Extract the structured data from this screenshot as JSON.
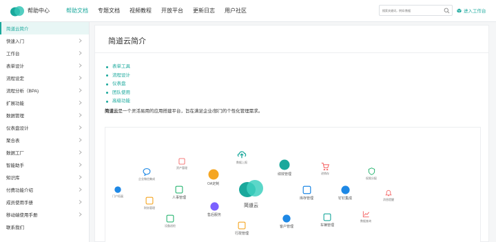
{
  "header": {
    "brand": "帮助中心",
    "nav": [
      "帮助文档",
      "专题文档",
      "视频教程",
      "开放平台",
      "更新日志",
      "用户社区"
    ],
    "active_nav": 0,
    "search_placeholder": "搜索关键词，例如:数据",
    "enter_workspace": "进入工作台",
    "accent_color": "#1aa89c",
    "icons": {
      "search": "search-icon",
      "workspace": "cube-icon",
      "logo": "cloud-logo"
    }
  },
  "sidebar": {
    "items": [
      {
        "label": "简道云简介",
        "active": true,
        "has_chevron": false
      },
      {
        "label": "快速入门",
        "has_chevron": true
      },
      {
        "label": "工作台",
        "has_chevron": true
      },
      {
        "label": "表单设计",
        "has_chevron": true
      },
      {
        "label": "流程设定",
        "has_chevron": true
      },
      {
        "label": "流程分析（BPA)",
        "has_chevron": true
      },
      {
        "label": "扩展功能",
        "has_chevron": true
      },
      {
        "label": "数据管理",
        "has_chevron": true
      },
      {
        "label": "仪表盘设计",
        "has_chevron": true
      },
      {
        "label": "聚合表",
        "has_chevron": true
      },
      {
        "label": "数据工厂",
        "has_chevron": true
      },
      {
        "label": "智能助手",
        "has_chevron": true
      },
      {
        "label": "知识库",
        "has_chevron": true
      },
      {
        "label": "付费功能介绍",
        "has_chevron": true
      },
      {
        "label": "成员使用手册",
        "has_chevron": true
      },
      {
        "label": "移动端使用手册",
        "has_chevron": true
      },
      {
        "label": "联系我们",
        "has_chevron": false
      }
    ]
  },
  "main": {
    "title": "简道云简介",
    "toc": [
      "表单工具",
      "流程设计",
      "仪表盘",
      "团队使用",
      "高级功能"
    ],
    "intro_bold": "简道云",
    "intro_rest": "是一个灵活易用的应用搭建平台，旨在满足企业/部门的个性化管理需求。"
  },
  "diagram": {
    "center_label": "简道云",
    "nodes": [
      {
        "label": "数据上报",
        "icon": "upload-icon",
        "color": "#1aa89c"
      },
      {
        "label": "绩效管理",
        "icon": "performance-icon",
        "color": "#1aa89c"
      },
      {
        "label": "资产管理",
        "icon": "asset-icon",
        "color": "#f56c6c"
      },
      {
        "label": "企业微信集成",
        "icon": "chat-icon",
        "color": "#1e88e5"
      },
      {
        "label": "OA定制",
        "icon": "oa-icon",
        "color": "#f5a623"
      },
      {
        "label": "进销存",
        "icon": "cart-icon",
        "color": "#f56c6c"
      },
      {
        "label": "权限分配",
        "icon": "shield-icon",
        "color": "#2bb673"
      },
      {
        "label": "人事管理",
        "icon": "person-card-icon",
        "color": "#2bb673"
      },
      {
        "label": "库存管理",
        "icon": "inventory-icon",
        "color": "#1e88e5"
      },
      {
        "label": "钉钉集成",
        "icon": "dingtalk-icon",
        "color": "#1e88e5"
      },
      {
        "label": "消息提醒",
        "icon": "bell-icon",
        "color": "#f56c6c"
      },
      {
        "label": "门户拓展",
        "icon": "portal-icon",
        "color": "#1e88e5"
      },
      {
        "label": "财务管理",
        "icon": "finance-icon",
        "color": "#f5a623"
      },
      {
        "label": "售后服务",
        "icon": "service-icon",
        "color": "#7b61ff"
      },
      {
        "label": "设备巡检",
        "icon": "inspection-icon",
        "color": "#2bb673"
      },
      {
        "label": "客户管理",
        "icon": "customer-icon",
        "color": "#1e88e5"
      },
      {
        "label": "车辆管理",
        "icon": "vehicle-icon",
        "color": "#1aa89c"
      },
      {
        "label": "数据查询",
        "icon": "chart-query-icon",
        "color": "#f56c6c"
      },
      {
        "label": "行政管理",
        "icon": "admin-icon",
        "color": "#f5a623"
      }
    ]
  }
}
